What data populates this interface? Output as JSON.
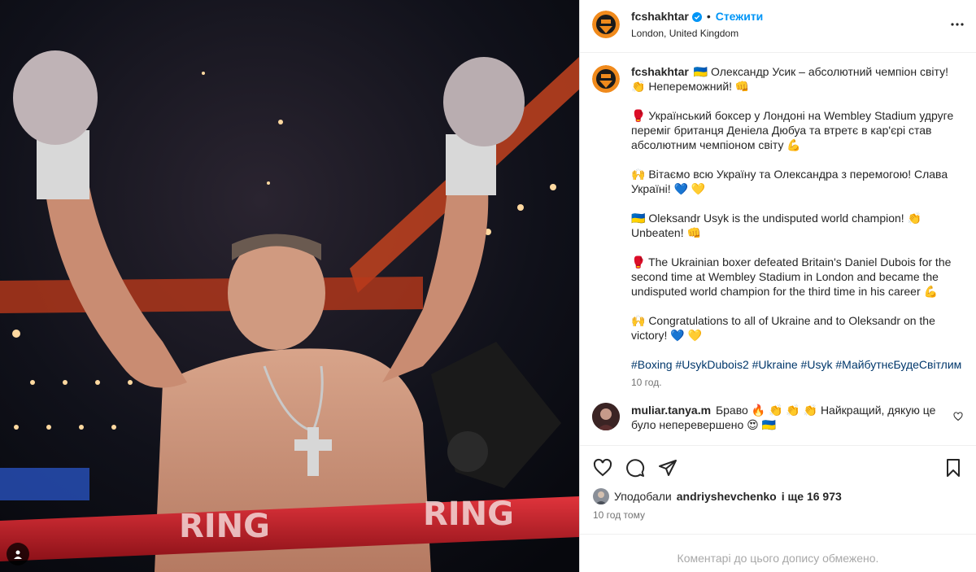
{
  "post": {
    "username": "fcshakhtar",
    "follow_label": "Стежити",
    "location": "London, United Kingdom",
    "caption_lines": [
      "🇺🇦 Олександр Усик – абсолютний чемпіон світу! 👏 Непереможний! 👊",
      "🥊 Український боксер у Лондоні на Wembley Stadium удруге переміг британця Деніела Дюбуа та втретє в кар'єрі став абсолютним чемпіоном світу 💪",
      "🙌 Вітаємо всю Україну та Олександра з перемогою! Слава Україні! 💙 💛",
      "🇺🇦 Oleksandr Usyk is the undisputed world champion! 👏 Unbeaten! 👊",
      "🥊 The Ukrainian boxer defeated Britain's Daniel Dubois for the second time at Wembley Stadium in London and became the undisputed world champion for the third time in his career 💪",
      "🙌 Congratulations to all of Ukraine and to Oleksandr on the victory! 💙 💛"
    ],
    "hashtags": "#Boxing #UsykDubois2 #Ukraine #Usyk #МайбутнєБудеСвітлим",
    "caption_time": "10 год.",
    "comment": {
      "username": "muliar.tanya.m",
      "text": "Браво 🔥 👏 👏 👏 Найкращий, дякую це було неперевершено 😍 🇺🇦"
    },
    "likes": {
      "prefix": "Уподобали",
      "user": "andriyshevchenko",
      "suffix": "і ще 16 973"
    },
    "post_time": "10 год тому",
    "comments_closed": "Коментарі до цього допису обмежено."
  },
  "media": {
    "ring_text": "RING"
  },
  "icons": {
    "verified": "verified-badge-icon",
    "more": "more-options-icon",
    "like": "heart-icon",
    "comment": "comment-icon",
    "share": "share-icon",
    "save": "bookmark-icon",
    "user_tag": "user-tag-icon"
  },
  "colors": {
    "accent": "#0095f6",
    "hashtag": "#00376b",
    "secondary_text": "#737373"
  }
}
